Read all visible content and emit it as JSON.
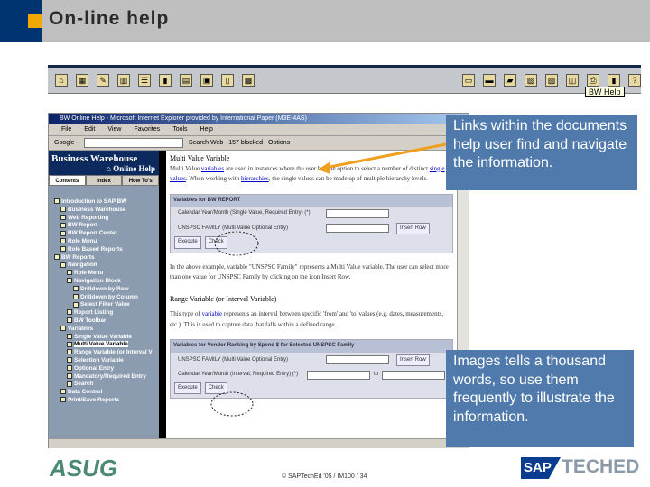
{
  "slide": {
    "title": "On-line help",
    "footer": "© SAPTechEd '05 / IM100 / 34",
    "logos": {
      "left": "ASUG",
      "right_sap": "SAP",
      "right_teched": "TECHED"
    }
  },
  "colors": {
    "title_block": "#003470",
    "accent": "#f0a800",
    "title_bar": "#bfbfbf",
    "callout": "#4f7aab",
    "arrow": "#f0a020"
  },
  "sap_toolbar": {
    "icons": [
      "home-icon",
      "calculator-icon",
      "pencil-icon",
      "table-icon",
      "list-icon",
      "chart-icon",
      "document-icon",
      "print-preview-icon",
      "filter-icon",
      "picture-icon",
      "save-icon",
      "save-as-icon",
      "open-folder-icon",
      "network-icon",
      "spreadsheet-icon",
      "csv-icon",
      "printer-icon",
      "bookmark-icon",
      "help-icon"
    ],
    "tooltip": "BW Help"
  },
  "browser": {
    "title": "BW Online Help - Microsoft Internet Explorer provided by International Paper (M3E-4AS)",
    "menu": [
      "File",
      "Edit",
      "View",
      "Favorites",
      "Tools",
      "Help"
    ],
    "google_bar": {
      "brand": "Google -",
      "search": "Search Web",
      "blocked": "157 blocked",
      "options": "Options"
    },
    "left_header": {
      "line1": "Business Warehouse",
      "line2": "Online Help"
    },
    "tabs": [
      "Contents",
      "Index",
      "How To's"
    ],
    "tree": [
      {
        "label": "Introduction to SAP BW",
        "indent": 0
      },
      {
        "label": "Business Warehouse",
        "indent": 1
      },
      {
        "label": "Web Reporting",
        "indent": 1
      },
      {
        "label": "BW Report",
        "indent": 1
      },
      {
        "label": "BW Report Center",
        "indent": 1
      },
      {
        "label": "Role Menu",
        "indent": 1
      },
      {
        "label": "Role Based Reports",
        "indent": 1
      },
      {
        "label": "BW Reports",
        "indent": 0
      },
      {
        "label": "Navigation",
        "indent": 1
      },
      {
        "label": "Role Menu",
        "indent": 2
      },
      {
        "label": "Navigation Block",
        "indent": 2
      },
      {
        "label": "Drilldown by Row",
        "indent": 3
      },
      {
        "label": "Drilldown by Column",
        "indent": 3
      },
      {
        "label": "Select Filter Value",
        "indent": 3
      },
      {
        "label": "Report Listing",
        "indent": 2
      },
      {
        "label": "BW Toolbar",
        "indent": 2
      },
      {
        "label": "Variables",
        "indent": 1
      },
      {
        "label": "Single Value Variable",
        "indent": 2
      },
      {
        "label": "Multi Value Variable",
        "indent": 2,
        "selected": true
      },
      {
        "label": "Range Variable (or Interval V",
        "indent": 2
      },
      {
        "label": "Selection Variable",
        "indent": 2
      },
      {
        "label": "Optional Entry",
        "indent": 2
      },
      {
        "label": "Mandatory/Required Entry",
        "indent": 2
      },
      {
        "label": "Search",
        "indent": 2
      },
      {
        "label": "Data Control",
        "indent": 1
      },
      {
        "label": "Print/Save Reports",
        "indent": 1
      }
    ],
    "content": {
      "h1": "Multi Value Variable",
      "p1_a": "Multi Value ",
      "p1_link1": "variables",
      "p1_b": " are used in instances where the user has the option to select a number of distinct ",
      "p1_link2": "single values",
      "p1_c": ". When working with ",
      "p1_link3": "hierarchies",
      "p1_d": ", the single values can be made up of multiple hierarchy levels.",
      "box1": {
        "header": "Variables for BW REPORT",
        "row1": "Calendar Year/Month (Single Value, Required Entry) (*)",
        "row2": "UNSPSC FAMILY (Multi Value Optional Entry)",
        "insert": "Insert Row",
        "execute": "Execute",
        "check": "Check"
      },
      "p2": "In the above example, variable \"UNSPSC Family\" represents a Multi Value variable. The user can select more than one value for UNSPSC Family by clicking on the icon Insert Row.",
      "h2": "Range Variable (or Interval Variable)",
      "p3_a": "This type of ",
      "p3_link": "variable",
      "p3_b": " represents an interval between specific 'from' and 'to' values (e.g. dates, measurements, etc.). This is used to capture data that falls within a defined range.",
      "box2": {
        "header": "Variables for Vendor Ranking by Spend $ for Selected UNSPSC Family",
        "row1": "UNSPSC FAMILY (Multi Value Optional Entry)",
        "row2": "Calendar Year/Month (Interval, Required Entry) (*)",
        "insert": "Insert Row",
        "to": "to",
        "execute": "Execute",
        "check": "Check"
      }
    }
  },
  "callouts": [
    "Links within the documents help user find and navigate the information.",
    "Images tells a thousand words, so use them frequently to illustrate the information."
  ]
}
